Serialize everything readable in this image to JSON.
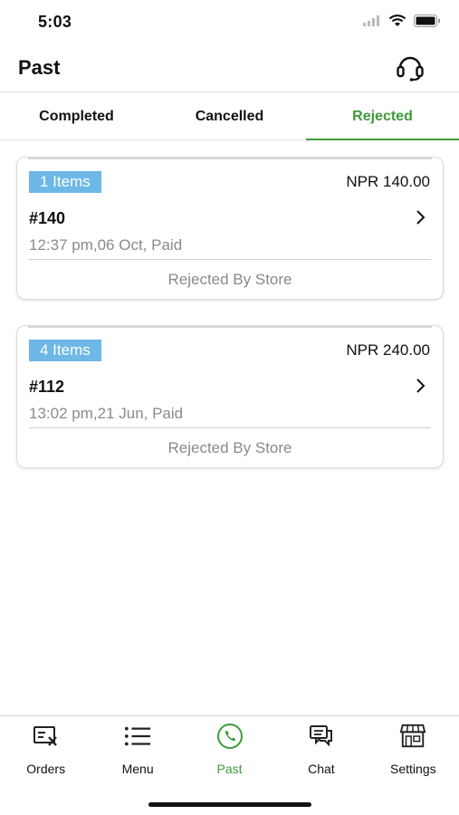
{
  "status_bar": {
    "time": "5:03"
  },
  "header": {
    "title": "Past",
    "support_icon": "headset-icon"
  },
  "tabs": [
    {
      "label": "Completed",
      "active": false
    },
    {
      "label": "Cancelled",
      "active": false
    },
    {
      "label": "Rejected",
      "active": true
    }
  ],
  "orders": [
    {
      "items": "1 Items",
      "price": "NPR 140.00",
      "number": "#140",
      "meta": "12:37 pm,06 Oct, Paid",
      "status": "Rejected By Store"
    },
    {
      "items": "4 Items",
      "price": "NPR 240.00",
      "number": "#112",
      "meta": "13:02 pm,21 Jun, Paid",
      "status": "Rejected By Store"
    }
  ],
  "bottom_nav": [
    {
      "label": "Orders",
      "icon": "orders-icon",
      "active": false
    },
    {
      "label": "Menu",
      "icon": "menu-list-icon",
      "active": false
    },
    {
      "label": "Past",
      "icon": "past-phone-icon",
      "active": true
    },
    {
      "label": "Chat",
      "icon": "chat-icon",
      "active": false
    },
    {
      "label": "Settings",
      "icon": "store-icon",
      "active": false
    }
  ],
  "colors": {
    "accent": "#3f9a3a",
    "badge": "#6db8e6",
    "muted": "#8a8a8a"
  }
}
